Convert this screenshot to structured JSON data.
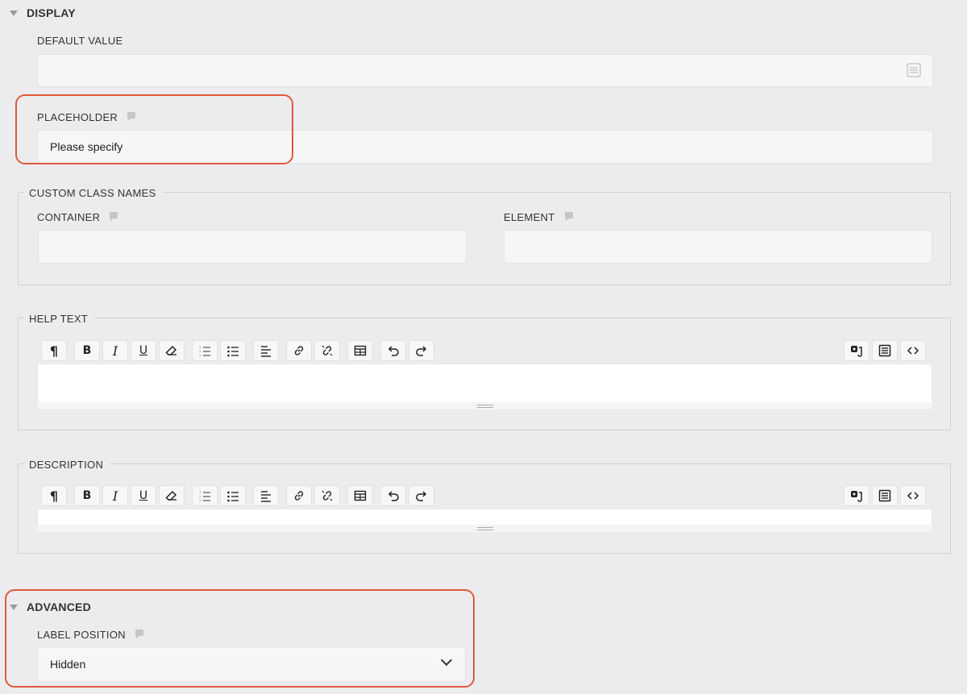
{
  "display": {
    "section_title": "DISPLAY",
    "default_value": {
      "label": "DEFAULT VALUE",
      "value": ""
    },
    "placeholder": {
      "label": "PLACEHOLDER",
      "value": "Please specify"
    },
    "custom_class_names": {
      "legend": "CUSTOM CLASS NAMES",
      "container": {
        "label": "CONTAINER",
        "value": ""
      },
      "element": {
        "label": "ELEMENT",
        "value": ""
      }
    },
    "help_text": {
      "legend": "HELP TEXT"
    },
    "description": {
      "legend": "DESCRIPTION"
    }
  },
  "toolbar": {
    "paragraph": "¶",
    "bold": "B",
    "italic": "I",
    "underline": "U"
  },
  "advanced": {
    "section_title": "ADVANCED",
    "label_position": {
      "label": "LABEL POSITION",
      "selected": "Hidden"
    }
  },
  "colors": {
    "highlight": "#e0593c",
    "background": "#ececee"
  }
}
